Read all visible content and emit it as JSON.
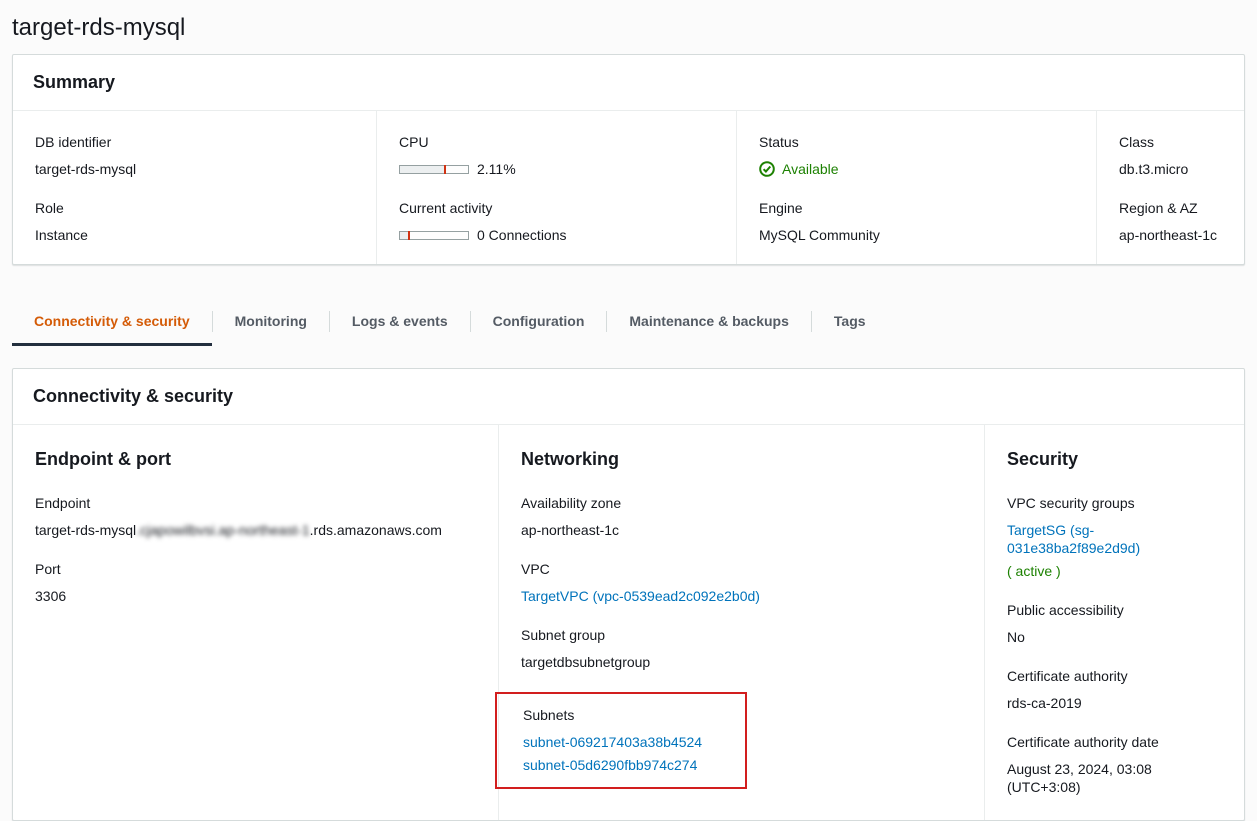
{
  "page": {
    "title": "target-rds-mysql"
  },
  "summary": {
    "title": "Summary",
    "fields": {
      "db_identifier": {
        "label": "DB identifier",
        "value": "target-rds-mysql"
      },
      "role": {
        "label": "Role",
        "value": "Instance"
      },
      "cpu": {
        "label": "CPU",
        "value": "2.11%"
      },
      "current_activity": {
        "label": "Current activity",
        "value": "0 Connections"
      },
      "status": {
        "label": "Status",
        "value": "Available"
      },
      "engine": {
        "label": "Engine",
        "value": "MySQL Community"
      },
      "class": {
        "label": "Class",
        "value": "db.t3.micro"
      },
      "region_az": {
        "label": "Region & AZ",
        "value": "ap-northeast-1c"
      }
    }
  },
  "tabs": [
    {
      "label": "Connectivity & security",
      "active": true
    },
    {
      "label": "Monitoring",
      "active": false
    },
    {
      "label": "Logs & events",
      "active": false
    },
    {
      "label": "Configuration",
      "active": false
    },
    {
      "label": "Maintenance & backups",
      "active": false
    },
    {
      "label": "Tags",
      "active": false
    }
  ],
  "connectivity": {
    "title": "Connectivity & security",
    "endpoint_port": {
      "title": "Endpoint & port",
      "endpoint_label": "Endpoint",
      "endpoint_prefix": "target-rds-mysql",
      "endpoint_redacted": ".cjapowilbvsi.ap-northeast-1",
      "endpoint_suffix": ".rds.amazonaws.com",
      "port_label": "Port",
      "port_value": "3306"
    },
    "networking": {
      "title": "Networking",
      "az_label": "Availability zone",
      "az_value": "ap-northeast-1c",
      "vpc_label": "VPC",
      "vpc_value": "TargetVPC (vpc-0539ead2c092e2b0d)",
      "subnet_group_label": "Subnet group",
      "subnet_group_value": "targetdbsubnetgroup",
      "subnets_label": "Subnets",
      "subnets": [
        "subnet-069217403a38b4524",
        "subnet-05d6290fbb974c274"
      ]
    },
    "security": {
      "title": "Security",
      "vpc_sg_label": "VPC security groups",
      "vpc_sg_value": "TargetSG (sg-031e38ba2f89e2d9d)",
      "vpc_sg_status": "( active )",
      "public_access_label": "Public accessibility",
      "public_access_value": "No",
      "ca_label": "Certificate authority",
      "ca_value": "rds-ca-2019",
      "ca_date_label": "Certificate authority date",
      "ca_date_value": "August 23, 2024, 03:08 (UTC+3:08)"
    }
  },
  "colors": {
    "link_blue": "#0073bb",
    "active_tab_orange": "#d45b07",
    "active_tab_underline": "#232f3e",
    "status_green": "#1d8102",
    "annotation_red": "#d21e1e",
    "gauge_marker_red": "#d13212"
  }
}
